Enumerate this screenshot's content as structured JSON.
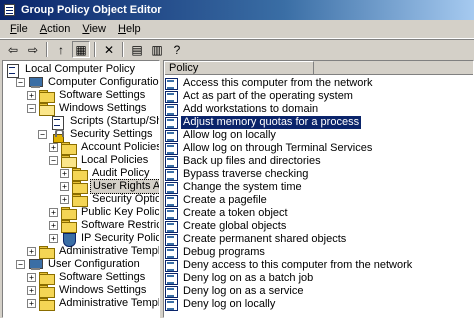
{
  "window": {
    "title": "Group Policy Object Editor",
    "icon": "gpedit-icon"
  },
  "menu": [
    {
      "label": "File",
      "accel": "F",
      "rest": "ile"
    },
    {
      "label": "Action",
      "accel": "A",
      "rest": "ction"
    },
    {
      "label": "View",
      "accel": "V",
      "rest": "iew"
    },
    {
      "label": "Help",
      "accel": "H",
      "rest": "elp"
    }
  ],
  "toolbar": [
    {
      "name": "back-arrow-icon",
      "glyph": "⇦"
    },
    {
      "name": "forward-arrow-icon",
      "glyph": "⇨"
    },
    {
      "name": "up-folder-icon",
      "glyph": "↑"
    },
    {
      "name": "show-hide-tree-icon",
      "glyph": "▦"
    },
    {
      "name": "delete-icon",
      "glyph": "✕"
    },
    {
      "name": "properties-icon",
      "glyph": "▤"
    },
    {
      "name": "export-list-icon",
      "glyph": "▥"
    },
    {
      "name": "help-icon",
      "glyph": "?"
    }
  ],
  "tree": [
    {
      "label": "Local Computer Policy",
      "icon": "policy-root-icon",
      "indent": 0,
      "expander": ""
    },
    {
      "label": "Computer Configuration",
      "icon": "computer-icon",
      "indent": 1,
      "expander": "−"
    },
    {
      "label": "Software Settings",
      "icon": "folder-icon",
      "indent": 2,
      "expander": "+"
    },
    {
      "label": "Windows Settings",
      "icon": "folder-open-icon",
      "indent": 2,
      "expander": "−"
    },
    {
      "label": "Scripts (Startup/Shutdown)",
      "icon": "script-doc-icon",
      "indent": 3,
      "expander": ""
    },
    {
      "label": "Security Settings",
      "icon": "security-icon",
      "indent": 3,
      "expander": "−"
    },
    {
      "label": "Account Policies",
      "icon": "folder-icon",
      "indent": 4,
      "expander": "+"
    },
    {
      "label": "Local Policies",
      "icon": "folder-open-icon",
      "indent": 4,
      "expander": "−"
    },
    {
      "label": "Audit Policy",
      "icon": "folder-icon",
      "indent": 5,
      "expander": "+"
    },
    {
      "label": "User Rights Assignment",
      "icon": "folder-icon",
      "indent": 5,
      "expander": "+",
      "selected": true
    },
    {
      "label": "Security Options",
      "icon": "folder-icon",
      "indent": 5,
      "expander": "+"
    },
    {
      "label": "Public Key Policies",
      "icon": "folder-icon",
      "indent": 4,
      "expander": "+"
    },
    {
      "label": "Software Restriction Policies",
      "icon": "folder-icon",
      "indent": 4,
      "expander": "+"
    },
    {
      "label": "IP Security Policies on Local Computer",
      "icon": "ip-security-icon",
      "indent": 4,
      "expander": "+"
    },
    {
      "label": "Administrative Templates",
      "icon": "folder-icon",
      "indent": 2,
      "expander": "+"
    },
    {
      "label": "User Configuration",
      "icon": "computer-icon",
      "indent": 1,
      "expander": "−"
    },
    {
      "label": "Software Settings",
      "icon": "folder-icon",
      "indent": 2,
      "expander": "+"
    },
    {
      "label": "Windows Settings",
      "icon": "folder-icon",
      "indent": 2,
      "expander": "+"
    },
    {
      "label": "Administrative Templates",
      "icon": "folder-icon",
      "indent": 2,
      "expander": "+"
    }
  ],
  "list": {
    "column_header": "Policy",
    "items": [
      {
        "label": "Access this computer from the network"
      },
      {
        "label": "Act as part of the operating system"
      },
      {
        "label": "Add workstations to domain"
      },
      {
        "label": "Adjust memory quotas for a process",
        "selected": true
      },
      {
        "label": "Allow log on locally"
      },
      {
        "label": "Allow log on through Terminal Services"
      },
      {
        "label": "Back up files and directories"
      },
      {
        "label": "Bypass traverse checking"
      },
      {
        "label": "Change the system time"
      },
      {
        "label": "Create a pagefile"
      },
      {
        "label": "Create a token object"
      },
      {
        "label": "Create global objects"
      },
      {
        "label": "Create permanent shared objects"
      },
      {
        "label": "Debug programs"
      },
      {
        "label": "Deny access to this computer from the network"
      },
      {
        "label": "Deny log on as a batch job"
      },
      {
        "label": "Deny log on as a service"
      },
      {
        "label": "Deny log on locally"
      }
    ]
  },
  "colors": {
    "title_active": "#0a246a",
    "selection": "#0a246a",
    "face": "#d4d0c8"
  }
}
